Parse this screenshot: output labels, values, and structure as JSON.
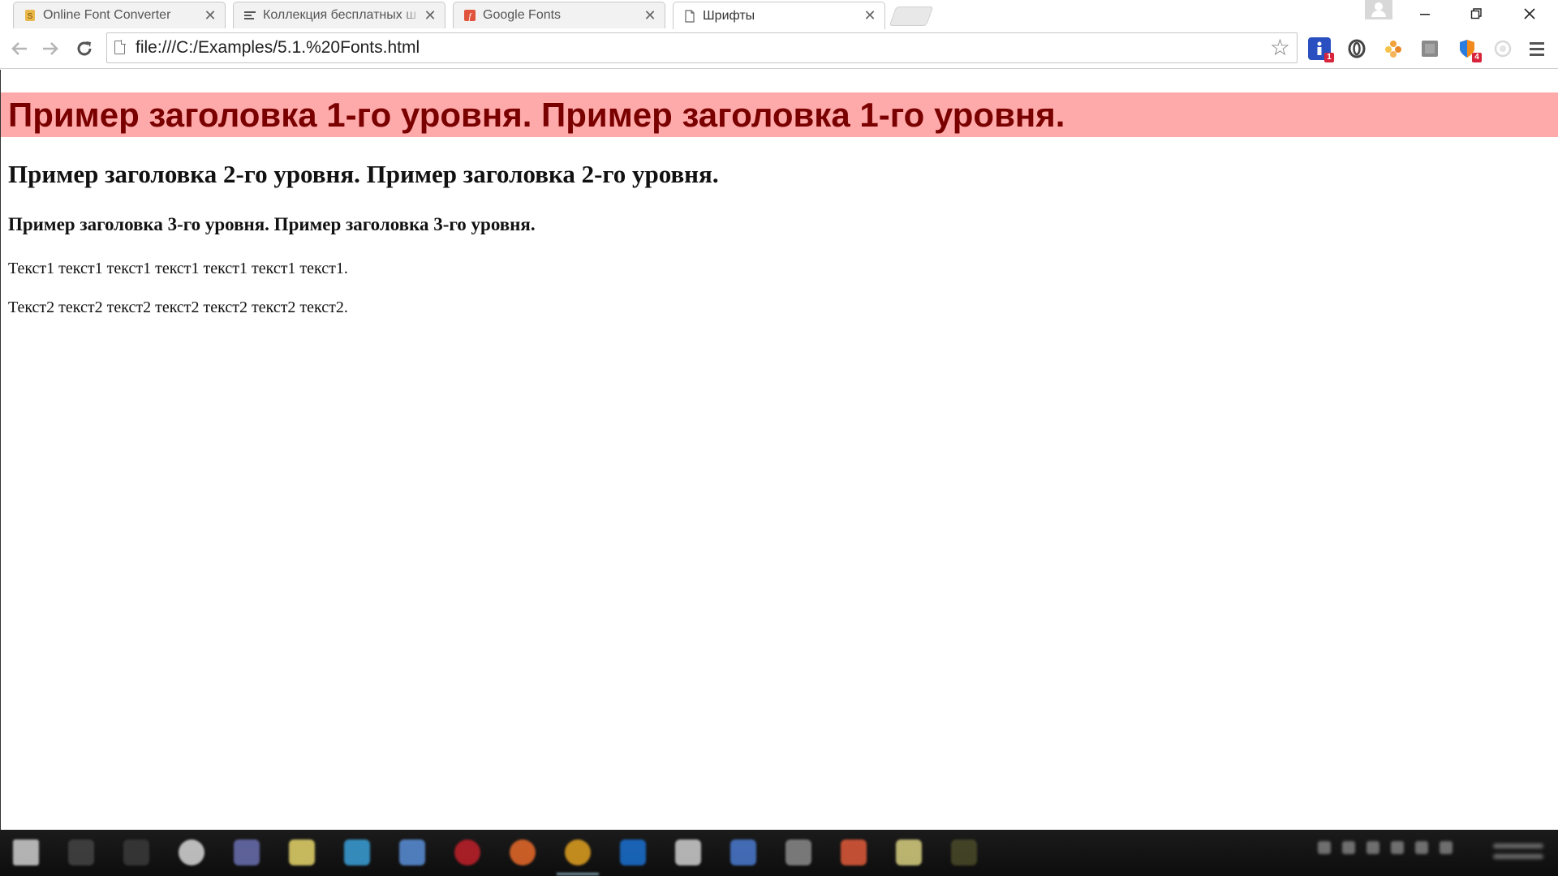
{
  "browser": {
    "tabs": [
      {
        "title": "Online Font Converter",
        "icon": "font-converter-favicon",
        "active": false
      },
      {
        "title": "Коллекция бесплатных ш",
        "icon": "list-favicon",
        "active": false
      },
      {
        "title": "Google Fonts",
        "icon": "google-fonts-favicon",
        "active": false
      },
      {
        "title": "Шрифты",
        "icon": "page-favicon",
        "active": true
      }
    ],
    "tab_close_glyph": "✕",
    "address": "file:///C:/Examples/5.1.%20Fonts.html",
    "extensions": [
      {
        "name": "info-extension-icon",
        "badge": "1",
        "color": "#2a4fc0"
      },
      {
        "name": "opera-extension-icon",
        "badge": "",
        "color": "#444444"
      },
      {
        "name": "flower-extension-icon",
        "badge": "",
        "color": "#f2a23a"
      },
      {
        "name": "gray-extension-icon",
        "badge": "",
        "color": "#8a8a8a"
      },
      {
        "name": "shield-extension-icon",
        "badge": "4",
        "color": "#f08a1c"
      },
      {
        "name": "circle-extension-icon",
        "badge": "",
        "color": "#d8d8d8"
      }
    ]
  },
  "page": {
    "h1": "Пример заголовка 1-го уровня. Пример заголовка 1-го уровня.",
    "h2": "Пример заголовка 2-го уровня. Пример заголовка 2-го уровня.",
    "h3": "Пример заголовка 3-го уровня. Пример заголовка 3-го уровня.",
    "p1": "Текст1 текст1 текст1 текст1 текст1 текст1 текст1.",
    "p2": "Текст2 текст2 текст2 текст2 текст2 текст2 текст2.",
    "h1_background": "#ffaaaa",
    "h1_color": "#7a0000"
  }
}
